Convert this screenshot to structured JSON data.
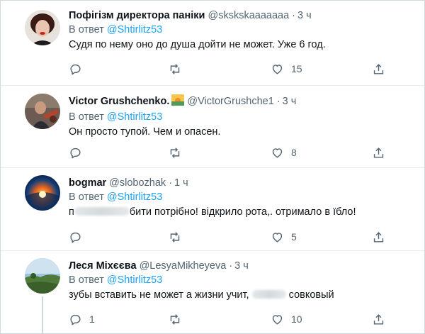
{
  "reply_prefix": "В ответ",
  "tweets": [
    {
      "name": "Пофігізм директора паніки",
      "handle": "@skskskaaaaaaa",
      "separator": "·",
      "time": "3 ч",
      "mention": "@Shtirlitz53",
      "text": "Судя по нему оно до душа дойти не может. Уже 6 год.",
      "replies": "",
      "retweets": "",
      "likes": "15"
    },
    {
      "name": "Victor Grushchenko.",
      "badge_icon": "sunset-emoji-icon",
      "handle": "@VictorGrushche1",
      "separator": "·",
      "time": "3 ч",
      "mention": "@Shtirlitz53",
      "text": "Он просто тупой. Чем и опасен.",
      "replies": "",
      "retweets": "",
      "likes": "8"
    },
    {
      "name": "bogmar",
      "handle": "@slobozhak",
      "separator": "·",
      "time": "1 ч",
      "mention": "@Shtirlitz53",
      "text_prefix": "п",
      "text": "бити потрібно! відкрило рота,. отримало в їбло!",
      "replies": "",
      "retweets": "",
      "likes": "5"
    },
    {
      "name": "Леся Міхєєва",
      "handle": "@LesyaMikheyeva",
      "separator": "·",
      "time": "3 ч",
      "mention": "@Shtirlitz53",
      "text_prefix": "зубы вставить не может а жизни учит,",
      "text": "совковый",
      "replies": "1",
      "retweets": "",
      "likes": "10"
    }
  ],
  "colors": {
    "mention": "#1da1f2",
    "secondary": "#536471",
    "text": "#0f1419",
    "divider": "#e6ecf0"
  }
}
